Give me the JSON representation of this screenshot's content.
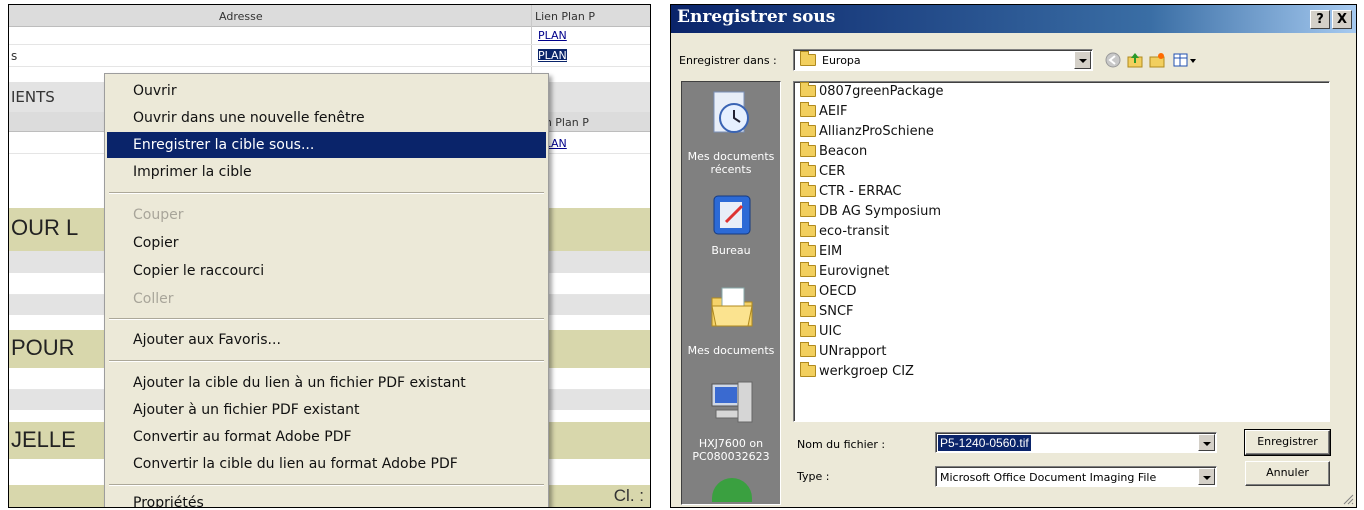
{
  "left": {
    "header": {
      "adresse": "Adresse",
      "lien_plan": "Lien Plan P"
    },
    "plan_links": [
      "PLAN",
      "PLAN"
    ],
    "row_s": "s",
    "ients": "IENTS",
    "lien_plan_2": "ien Plan P",
    "plan_link_3": "PLAN",
    "big_text_1": "OUR L",
    "big_text_2": "POUR",
    "big_text_3": "JELLE",
    "cl": "Cl. :",
    "context_menu": {
      "open": "Ouvrir",
      "open_new_window": "Ouvrir dans une nouvelle fenêtre",
      "save_target": "Enregistrer la cible sous...",
      "print_target": "Imprimer la cible",
      "cut": "Couper",
      "copy": "Copier",
      "copy_shortcut": "Copier le raccourci",
      "paste": "Coller",
      "add_favorites": "Ajouter aux Favoris...",
      "add_target_pdf": "Ajouter la cible du lien à un fichier PDF existant",
      "add_to_pdf": "Ajouter à un fichier PDF existant",
      "convert_pdf": "Convertir au format Adobe PDF",
      "convert_target_pdf": "Convertir la cible du lien au format Adobe PDF",
      "properties": "Propriétés"
    }
  },
  "dialog": {
    "title": "Enregistrer sous",
    "help_btn": "?",
    "close_btn": "X",
    "save_in_label": "Enregistrer dans :",
    "save_in_value": "Europa",
    "places": {
      "recent": "Mes documents récents",
      "desktop": "Bureau",
      "my_documents": "Mes documents",
      "computer": "HXJ7600 on PC080032623"
    },
    "folders": [
      "0807greenPackage",
      "AEIF",
      "AllianzProSchiene",
      "Beacon",
      "CER",
      "CTR - ERRAC",
      "DB AG Symposium",
      "eco-transit",
      "EIM",
      "Eurovignet",
      "OECD",
      "SNCF",
      "UIC",
      "UNrapport",
      "werkgroep CIZ"
    ],
    "filename_label": "Nom du fichier :",
    "filename_value": "P5-1240-0560.tif",
    "type_label": "Type :",
    "type_value": "Microsoft Office Document Imaging File",
    "save_button": "Enregistrer",
    "cancel_button": "Annuler"
  }
}
